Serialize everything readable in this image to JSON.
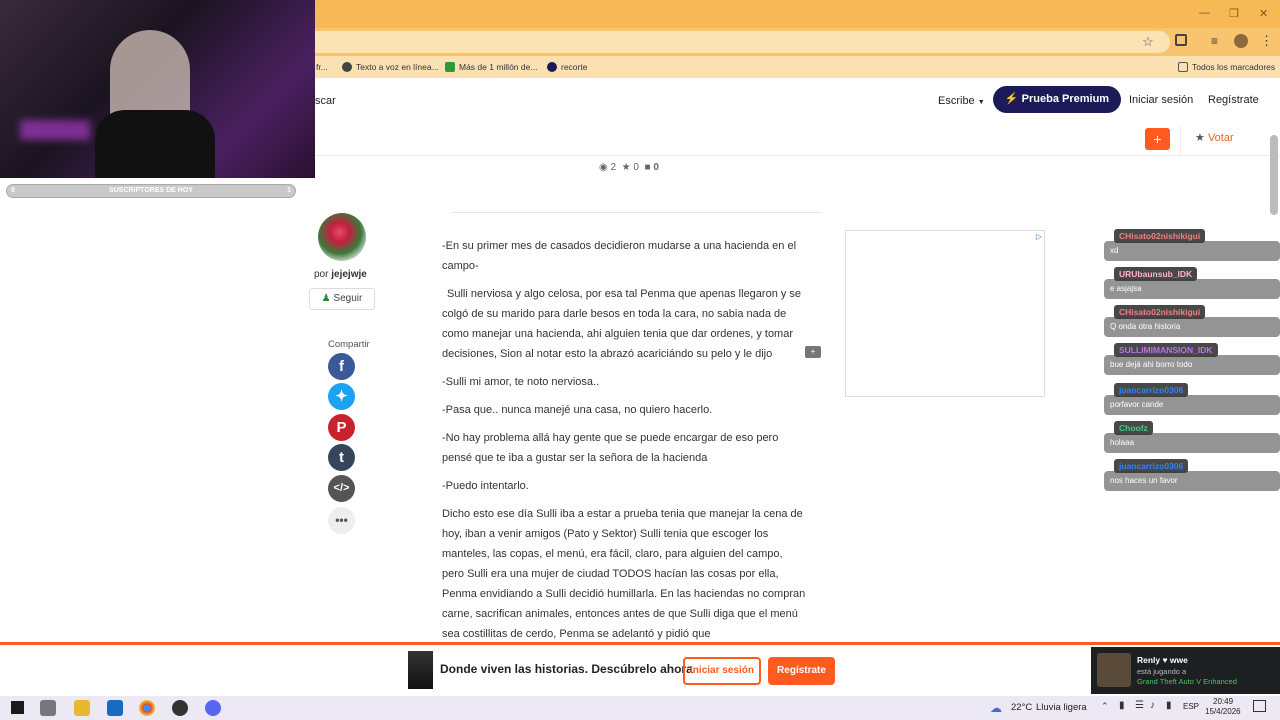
{
  "browser": {
    "bookmarks": [
      "fr...",
      "Texto a voz en línea...",
      "Más de 1 millón de...",
      "recorte"
    ],
    "all_bookmarks_label": "Todos los marcadores"
  },
  "overlay": {
    "subscribers_label": "SUSCRIPTORES DE HOY",
    "subscribers_count": "0",
    "subscribers_goal": "1"
  },
  "header": {
    "search_label": "scar",
    "write_label": "Escribe",
    "premium_label": "Prueba Premium",
    "login_label": "Iniciar sesión",
    "register_label": "Regístrate",
    "plus_label": "+",
    "vote_label": "Votar"
  },
  "stats": {
    "views": "2",
    "votes": "0",
    "comments": "0"
  },
  "author": {
    "by_label": "por",
    "username": "jejejwje",
    "follow_label": "Seguir",
    "share_label": "Compartir"
  },
  "article": {
    "paragraphs": [
      "-En su primer mes de casados decidieron mudarse a una hacienda en el campo-",
      "Sulli nerviosa y algo celosa, por esa tal Penma que apenas llegaron y se colgó de su marido para darle besos en toda la cara, no sabia nada de como manejar una hacienda, ahi alguien tenia que dar ordenes, y tomar decisiones, Sion al notar esto la abrazó acariciándo su pelo y le dijo",
      "-Sulli mi amor, te noto nerviosa..",
      "-Pasa que.. nunca manejé una casa, no quiero hacerlo.",
      "-No hay problema allá hay gente que se puede encargar de eso pero pensé que te iba a gustar ser la señora de la hacienda",
      "-Puedo intentarlo.",
      "Dicho esto ese día Sulli iba a estar a prueba tenia que manejar la cena de hoy, iban a venir amigos (Pato y Sektor) Sulli tenia que escoger los manteles, las copas, el menú, era fácil, claro, para alguien del campo, pero Sulli era una mujer de ciudad TODOS hacían las cosas por ella, Penma envidiando a Sulli decidió humillarla. En las haciendas no compran carne, sacrifican animales, entonces antes de que Sulli diga que el menú sea costillitas de cerdo, Penma se adelantó y pidió que"
    ]
  },
  "chat": [
    {
      "user": "CHisato02nishikigui",
      "message": "xd",
      "color": "#f08080"
    },
    {
      "user": "URUbaunsub_IDK",
      "message": "e asjajsa",
      "color": "#ffb0d0"
    },
    {
      "user": "CHisato02nishikigui",
      "message": "Q onda otra historia",
      "color": "#f08080"
    },
    {
      "user": "SULLIMIMANSION_IDK",
      "message": "bue dejá ahi borro todo",
      "color": "#c070f0"
    },
    {
      "user": "juancarrizo0306",
      "message": "porfavor cande",
      "color": "#3080ff"
    },
    {
      "user": "Choofz",
      "message": "holaaa",
      "color": "#40d080"
    },
    {
      "user": "juancarrizo0306",
      "message": "nos haces un favor",
      "color": "#3080ff"
    }
  ],
  "bottom_banner": {
    "text": "Donde viven las historias. Descúbrelo ahora",
    "login_label": "Iniciar sesión",
    "register_label": "Regístrate"
  },
  "notification": {
    "user": "Renly ♥ wwe",
    "line2": "está jugando a",
    "game": "Grand Theft Auto V Enhanced"
  },
  "taskbar": {
    "weather_temp": "22°C",
    "weather_desc": "Lluvia ligera",
    "lang": "ESP",
    "time": "20:49",
    "date": "15/4/2026"
  },
  "colors": {
    "accent": "#ff5a1f",
    "premium": "#1d1a5a",
    "chrome": "#f7b955"
  }
}
